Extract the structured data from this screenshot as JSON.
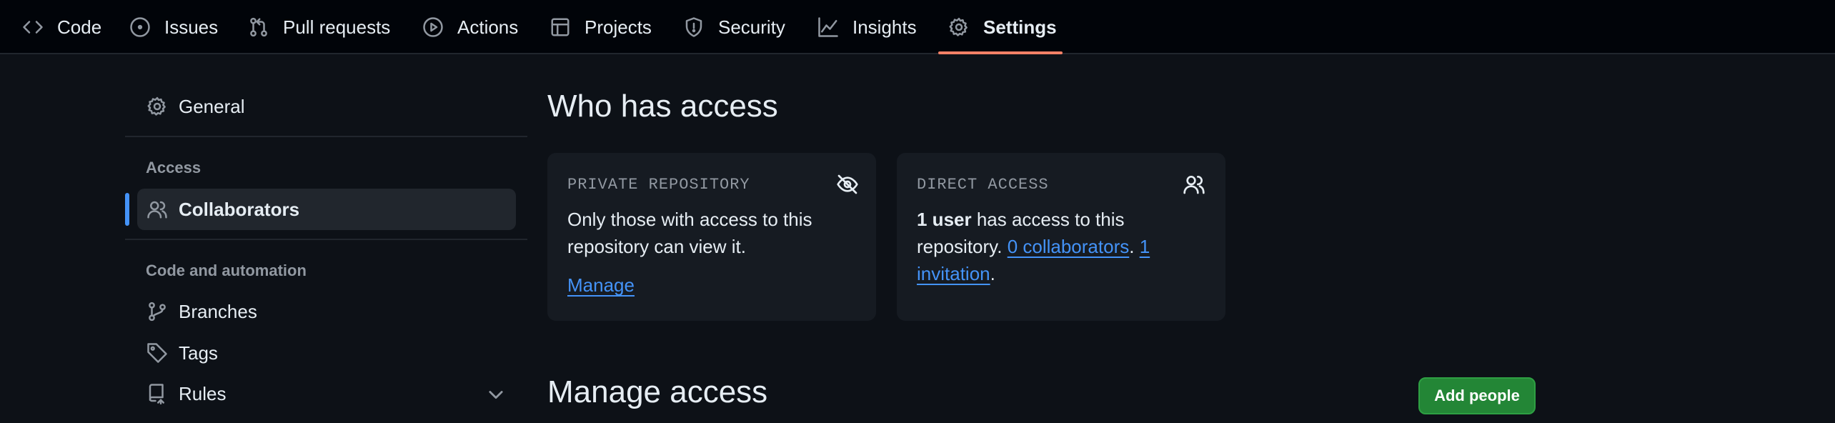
{
  "nav": {
    "tabs": [
      {
        "label": "Code",
        "icon": "code-icon"
      },
      {
        "label": "Issues",
        "icon": "issue-opened-icon"
      },
      {
        "label": "Pull requests",
        "icon": "git-pull-request-icon"
      },
      {
        "label": "Actions",
        "icon": "play-icon"
      },
      {
        "label": "Projects",
        "icon": "table-icon"
      },
      {
        "label": "Security",
        "icon": "shield-icon"
      },
      {
        "label": "Insights",
        "icon": "graph-icon"
      },
      {
        "label": "Settings",
        "icon": "gear-icon"
      }
    ],
    "active": "Settings",
    "accent_color": "#f78166"
  },
  "sidebar": {
    "general": {
      "label": "General",
      "icon": "gear-icon"
    },
    "access_heading": "Access",
    "collaborators": {
      "label": "Collaborators",
      "icon": "people-icon"
    },
    "code_heading": "Code and automation",
    "branches": {
      "label": "Branches",
      "icon": "git-branch-icon"
    },
    "tags": {
      "label": "Tags",
      "icon": "tag-icon"
    },
    "rules": {
      "label": "Rules",
      "icon": "repo-push-icon"
    }
  },
  "main": {
    "title": "Who has access",
    "private_card": {
      "title": "PRIVATE REPOSITORY",
      "icon": "eye-closed-icon",
      "text": "Only those with access to this repository can view it.",
      "link": "Manage"
    },
    "direct_card": {
      "title": "DIRECT ACCESS",
      "icon": "people-icon",
      "strong": "1 user",
      "text1": " has access to this repository. ",
      "link1": "0 collaborators",
      "sep": ". ",
      "link2": "1 invitation",
      "end": "."
    },
    "manage_title": "Manage access",
    "add_button": "Add people",
    "button_color": "#238636"
  }
}
